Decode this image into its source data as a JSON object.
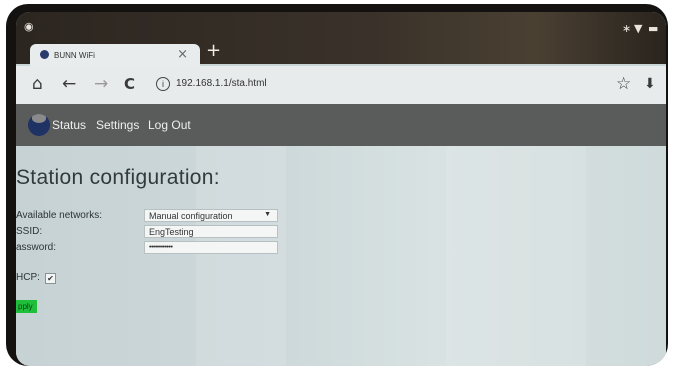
{
  "system": {
    "status_icons": [
      "bluetooth-icon",
      "wifi-icon",
      "battery-icon"
    ],
    "bluetooth_glyph": "∗",
    "wifi_glyph": "▼",
    "battery_glyph": "▬"
  },
  "tab": {
    "title": "BUNN WiFi",
    "close_glyph": "×",
    "new_tab_glyph": "+"
  },
  "toolbar": {
    "home_glyph": "⌂",
    "back_glyph": "←",
    "forward_glyph": "→",
    "reload_glyph": "C",
    "info_glyph": "i",
    "url": "192.168.1.1/sta.html",
    "star_glyph": "☆",
    "download_glyph": "⬇"
  },
  "nav": {
    "items": [
      {
        "label": "Status"
      },
      {
        "label": "Settings"
      },
      {
        "label": "Log Out"
      }
    ]
  },
  "page": {
    "heading": "Station configuration:",
    "networks_label": "Available networks:",
    "networks_value": "Manual configuration",
    "ssid_label": "SSID:",
    "ssid_value": "EngTesting",
    "password_label": "assword:",
    "password_value": "••••••••••••",
    "dhcp_label": "HCP:",
    "dhcp_checked": true,
    "dhcp_check_glyph": "✔",
    "apply_label": "pply"
  },
  "colors": {
    "nav_bar": "#5a5c5c",
    "apply_button": "#1fbf3c",
    "logo": "#1f3264"
  }
}
